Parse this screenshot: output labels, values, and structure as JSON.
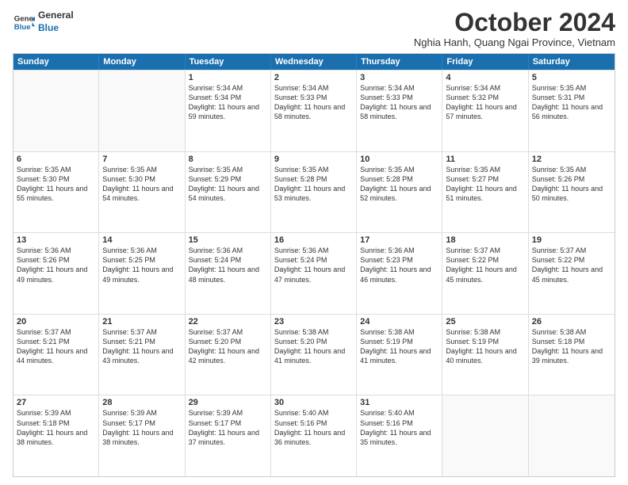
{
  "logo": {
    "line1": "General",
    "line2": "Blue"
  },
  "title": "October 2024",
  "location": "Nghia Hanh, Quang Ngai Province, Vietnam",
  "days": [
    "Sunday",
    "Monday",
    "Tuesday",
    "Wednesday",
    "Thursday",
    "Friday",
    "Saturday"
  ],
  "rows": [
    [
      {
        "day": "",
        "text": ""
      },
      {
        "day": "",
        "text": ""
      },
      {
        "day": "1",
        "text": "Sunrise: 5:34 AM\nSunset: 5:34 PM\nDaylight: 11 hours and 59 minutes."
      },
      {
        "day": "2",
        "text": "Sunrise: 5:34 AM\nSunset: 5:33 PM\nDaylight: 11 hours and 58 minutes."
      },
      {
        "day": "3",
        "text": "Sunrise: 5:34 AM\nSunset: 5:33 PM\nDaylight: 11 hours and 58 minutes."
      },
      {
        "day": "4",
        "text": "Sunrise: 5:34 AM\nSunset: 5:32 PM\nDaylight: 11 hours and 57 minutes."
      },
      {
        "day": "5",
        "text": "Sunrise: 5:35 AM\nSunset: 5:31 PM\nDaylight: 11 hours and 56 minutes."
      }
    ],
    [
      {
        "day": "6",
        "text": "Sunrise: 5:35 AM\nSunset: 5:30 PM\nDaylight: 11 hours and 55 minutes."
      },
      {
        "day": "7",
        "text": "Sunrise: 5:35 AM\nSunset: 5:30 PM\nDaylight: 11 hours and 54 minutes."
      },
      {
        "day": "8",
        "text": "Sunrise: 5:35 AM\nSunset: 5:29 PM\nDaylight: 11 hours and 54 minutes."
      },
      {
        "day": "9",
        "text": "Sunrise: 5:35 AM\nSunset: 5:28 PM\nDaylight: 11 hours and 53 minutes."
      },
      {
        "day": "10",
        "text": "Sunrise: 5:35 AM\nSunset: 5:28 PM\nDaylight: 11 hours and 52 minutes."
      },
      {
        "day": "11",
        "text": "Sunrise: 5:35 AM\nSunset: 5:27 PM\nDaylight: 11 hours and 51 minutes."
      },
      {
        "day": "12",
        "text": "Sunrise: 5:35 AM\nSunset: 5:26 PM\nDaylight: 11 hours and 50 minutes."
      }
    ],
    [
      {
        "day": "13",
        "text": "Sunrise: 5:36 AM\nSunset: 5:26 PM\nDaylight: 11 hours and 49 minutes."
      },
      {
        "day": "14",
        "text": "Sunrise: 5:36 AM\nSunset: 5:25 PM\nDaylight: 11 hours and 49 minutes."
      },
      {
        "day": "15",
        "text": "Sunrise: 5:36 AM\nSunset: 5:24 PM\nDaylight: 11 hours and 48 minutes."
      },
      {
        "day": "16",
        "text": "Sunrise: 5:36 AM\nSunset: 5:24 PM\nDaylight: 11 hours and 47 minutes."
      },
      {
        "day": "17",
        "text": "Sunrise: 5:36 AM\nSunset: 5:23 PM\nDaylight: 11 hours and 46 minutes."
      },
      {
        "day": "18",
        "text": "Sunrise: 5:37 AM\nSunset: 5:22 PM\nDaylight: 11 hours and 45 minutes."
      },
      {
        "day": "19",
        "text": "Sunrise: 5:37 AM\nSunset: 5:22 PM\nDaylight: 11 hours and 45 minutes."
      }
    ],
    [
      {
        "day": "20",
        "text": "Sunrise: 5:37 AM\nSunset: 5:21 PM\nDaylight: 11 hours and 44 minutes."
      },
      {
        "day": "21",
        "text": "Sunrise: 5:37 AM\nSunset: 5:21 PM\nDaylight: 11 hours and 43 minutes."
      },
      {
        "day": "22",
        "text": "Sunrise: 5:37 AM\nSunset: 5:20 PM\nDaylight: 11 hours and 42 minutes."
      },
      {
        "day": "23",
        "text": "Sunrise: 5:38 AM\nSunset: 5:20 PM\nDaylight: 11 hours and 41 minutes."
      },
      {
        "day": "24",
        "text": "Sunrise: 5:38 AM\nSunset: 5:19 PM\nDaylight: 11 hours and 41 minutes."
      },
      {
        "day": "25",
        "text": "Sunrise: 5:38 AM\nSunset: 5:19 PM\nDaylight: 11 hours and 40 minutes."
      },
      {
        "day": "26",
        "text": "Sunrise: 5:38 AM\nSunset: 5:18 PM\nDaylight: 11 hours and 39 minutes."
      }
    ],
    [
      {
        "day": "27",
        "text": "Sunrise: 5:39 AM\nSunset: 5:18 PM\nDaylight: 11 hours and 38 minutes."
      },
      {
        "day": "28",
        "text": "Sunrise: 5:39 AM\nSunset: 5:17 PM\nDaylight: 11 hours and 38 minutes."
      },
      {
        "day": "29",
        "text": "Sunrise: 5:39 AM\nSunset: 5:17 PM\nDaylight: 11 hours and 37 minutes."
      },
      {
        "day": "30",
        "text": "Sunrise: 5:40 AM\nSunset: 5:16 PM\nDaylight: 11 hours and 36 minutes."
      },
      {
        "day": "31",
        "text": "Sunrise: 5:40 AM\nSunset: 5:16 PM\nDaylight: 11 hours and 35 minutes."
      },
      {
        "day": "",
        "text": ""
      },
      {
        "day": "",
        "text": ""
      }
    ]
  ]
}
